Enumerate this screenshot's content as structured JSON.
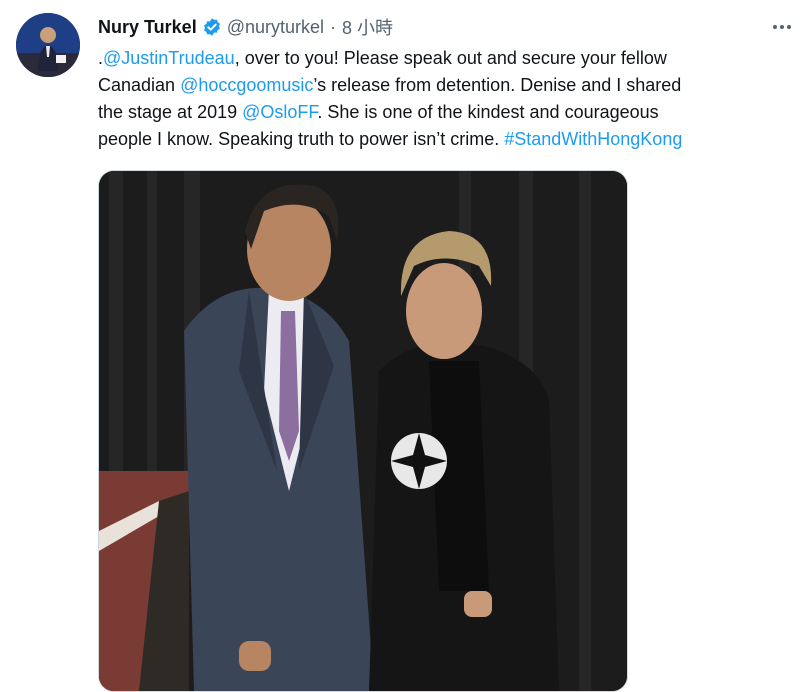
{
  "tweet": {
    "author": {
      "display_name": "Nury Turkel",
      "handle": "@nuryturkel",
      "verified_icon": "verified-badge-icon",
      "avatar_icon": "avatar"
    },
    "separator": "·",
    "timestamp": "8 小時",
    "more_icon": "more-options-icon",
    "text": {
      "l1a": ".",
      "l1_mention": "@JustinTrudeau",
      "l1b": ", over to you! Please speak out and secure your fellow",
      "l2a": "Canadian ",
      "l2_mention": "@hoccgoomusic",
      "l2b": "’s release from detention. Denise and I shared",
      "l3a": "the stage at 2019 ",
      "l3_mention": "@OsloFF",
      "l3b": ". She is one of the kindest and courageous",
      "l4a": "people I know.  Speaking truth to power isn’t crime. ",
      "l4_hashtag": "#StandWithHongKong"
    },
    "media_icon": "photo"
  },
  "colors": {
    "link": "#1d9bf0",
    "text": "#0f1419",
    "secondary": "#536471",
    "verified": "#1d9bf0"
  }
}
